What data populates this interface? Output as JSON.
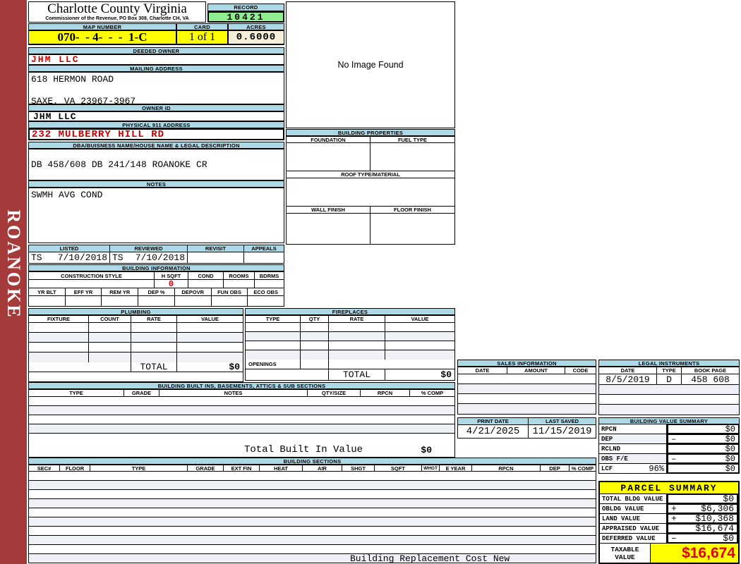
{
  "colors": {
    "sidebar_red": "#A43A3A",
    "band_blue": "#ADD8E6",
    "highlight_yellow": "#FFFF00",
    "record_green": "#90EE90",
    "acres_cream": "#F5EFDA",
    "red_text": "#C80000",
    "stripe": "#EFF1F6"
  },
  "sidebar": {
    "label": "ROANOKE"
  },
  "header": {
    "county": "Charlotte County Virginia",
    "subtitle": "Commissioner of the Revenue, PO Box 308, Charlotte CH, VA",
    "record_label": "RECORD",
    "record_value": "10421",
    "map_label": "MAP NUMBER",
    "map_value": "070-  - 4-  -  -  1-C",
    "card_label": "CARD",
    "card_value": "1 of 1",
    "acres_label": "ACRES",
    "acres_value": "0.6000"
  },
  "owner": {
    "deeded_label": "DEEDED OWNER",
    "deeded_value": "JHM LLC",
    "mailing_label": "MAILING ADDRESS",
    "address_line1": "618 HERMON ROAD",
    "address_line2": "SAXE, VA 23967-3967",
    "owner_id_label": "OWNER ID",
    "owner_id_value": "JHM LLC",
    "physical_label": "PHYSICAL 911 ADDRESS",
    "physical_value": "232 MULBERRY HILL RD",
    "dba_label": "DBA/BUISNESS NAME/HOUSE NAME & LEGAL DESCRIPTION",
    "dba_value": "DB 458/608 DB 241/148 ROANOKE CR",
    "notes_label": "NOTES",
    "notes_value": "SWMH AVG COND"
  },
  "review": {
    "listed_label": "LISTED",
    "listed_by": "TS",
    "listed_date": "7/10/2018",
    "reviewed_label": "REVIEWED",
    "reviewed_by": "TS",
    "reviewed_date": "7/10/2018",
    "revisit_label": "REVISIT",
    "appeals_label": "APPEALS"
  },
  "building_info": {
    "title": "BUILDING INFORMATION",
    "headers1": [
      "CONSTRUCTION STYLE",
      "H SQFT",
      "COND",
      "ROOMS",
      "BDRMS"
    ],
    "h_sqft": "0",
    "headers2": [
      "YR BLT",
      "EFF YR",
      "REM YR",
      "DEP %",
      "DEPOVR",
      "FUN OBS",
      "ECO OBS"
    ]
  },
  "plumbing": {
    "title": "PLUMBING",
    "headers": [
      "FIXTURE",
      "COUNT",
      "RATE",
      "VALUE"
    ],
    "total_label": "TOTAL",
    "total_value": "$0"
  },
  "fireplaces": {
    "title": "FIREPLACES",
    "headers": [
      "TYPE",
      "QTY",
      "RATE",
      "VALUE"
    ],
    "openings_label": "OPENINGS",
    "total_label": "TOTAL",
    "total_value": "$0"
  },
  "built_ins": {
    "title": "BUILDING BUILT INS, BASEMENTS, ATTICS & SUB SECTIONS",
    "headers": [
      "TYPE",
      "GRADE",
      "NOTES",
      "QTY/SIZE",
      "RPCN",
      "% COMP"
    ],
    "total_label": "Total Built In Value",
    "total_value": "$0"
  },
  "building_sections": {
    "title": "BUILDING SECTIONS",
    "headers": [
      "SEC#",
      "FLOOR",
      "TYPE",
      "GRADE",
      "EXT FIN",
      "HEAT",
      "AIR",
      "SHGT",
      "SQFT",
      "WHGT",
      "E YEAR",
      "RPCN",
      "DEP",
      "% COMP"
    ]
  },
  "image_panel": {
    "placeholder": "No Image Found"
  },
  "building_properties": {
    "title": "BUILDING PROPERTIES",
    "foundation": "FOUNDATION",
    "fuel": "FUEL TYPE",
    "roof": "ROOF TYPE/MATERIAL",
    "wall": "WALL FINISH",
    "floor": "FLOOR FINISH"
  },
  "sales": {
    "title": "SALES INFORMATION",
    "headers": [
      "DATE",
      "AMOUNT",
      "CODE"
    ]
  },
  "legal": {
    "title": "LEGAL INSTRUMENTS",
    "headers": [
      "DATE",
      "TYPE",
      "BOOK PAGE"
    ],
    "row1": {
      "date": "8/5/2019",
      "type": "D",
      "book_page": "458 608"
    }
  },
  "dates": {
    "print_label": "PRINT DATE",
    "print_value": "4/21/2025",
    "saved_label": "LAST SAVED",
    "saved_value": "11/15/2019"
  },
  "value_summary": {
    "title": "BUILDING VALUE SUMMARY",
    "rows": [
      {
        "label": "RPCN",
        "op": "",
        "value": "$0"
      },
      {
        "label": "DEP",
        "op": "–",
        "value": "$0"
      },
      {
        "label": "RCLND",
        "op": "",
        "value": "$0"
      },
      {
        "label": "OBS F/E",
        "op": "–",
        "value": "$0"
      },
      {
        "label": "LCF",
        "pct": "96%",
        "op": "",
        "value": "$0"
      }
    ]
  },
  "parcel_summary": {
    "title": "PARCEL SUMMARY",
    "rows": [
      {
        "label": "TOTAL BLDG VALUE",
        "op": "",
        "value": "$0"
      },
      {
        "label": "OBLDG VALUE",
        "op": "+",
        "value": "$6,306"
      },
      {
        "label": "LAND VALUE",
        "op": "+",
        "value": "$10,368"
      },
      {
        "label": "APPRAISED VALUE",
        "op": "",
        "value": "$16,674"
      },
      {
        "label": "DEFERRED VALUE",
        "op": "–",
        "value": "$0"
      }
    ],
    "taxable_line1": "TAXABLE",
    "taxable_line2": "VALUE",
    "taxable_value": "$16,674"
  },
  "footer": {
    "note": "Building Replacement Cost New"
  }
}
